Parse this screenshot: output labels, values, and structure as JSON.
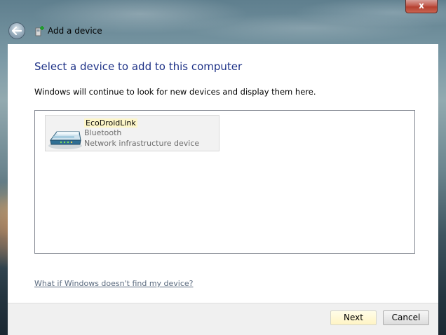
{
  "window": {
    "close_glyph": "x"
  },
  "titlebar": {
    "title": "Add a device",
    "back_icon": "back-arrow-icon",
    "app_icon": "add-device-icon"
  },
  "main": {
    "heading": "Select a device to add to this computer",
    "subtext": "Windows will continue to look for new devices and display them here.",
    "devices": [
      {
        "name": "EcoDroidLink",
        "type": "Bluetooth",
        "category": "Network infrastructure device",
        "icon": "network-device-icon"
      }
    ],
    "help_link": "What if Windows doesn't find my device?"
  },
  "footer": {
    "next_label": "Next",
    "cancel_label": "Cancel"
  },
  "colors": {
    "heading": "#1e3287",
    "link": "#5b6b7f",
    "selection_highlight": "#fdf6c9",
    "close_button": "#c25a4c"
  }
}
